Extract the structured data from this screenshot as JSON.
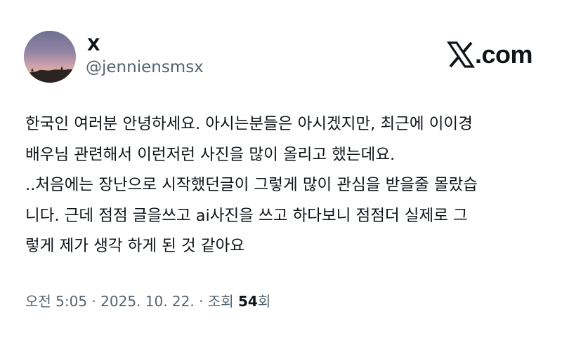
{
  "author": {
    "name": "X",
    "handle": "@jenniensmsx"
  },
  "brand": {
    "text": ".com",
    "logo_icon": "x-logo-icon"
  },
  "tweet": {
    "lines": [
      "한국인 여러분 안녕하세요. 아시는분들은 아시겠지만, 최근에 이이경",
      "배우님 관련해서 이런저런 사진을 많이 올리고 했는데요.",
      "..처음에는 장난으로 시작했던글이 그렇게 많이 관심을 받을줄 몰랐습",
      "니다. 근데 점점 글을쓰고 ai사진을 쓰고 하다보니 점점더 실제로 그",
      "렇게 제가 생각 하게 된 것 같아요"
    ]
  },
  "meta": {
    "time": "오전 5:05",
    "separator": " · ",
    "date": "2025. 10. 22.",
    "views_label": "조회 ",
    "views_count": "54",
    "views_suffix": "회"
  },
  "colors": {
    "text_primary": "#0f1419",
    "text_secondary": "#536471",
    "background": "#ffffff"
  }
}
